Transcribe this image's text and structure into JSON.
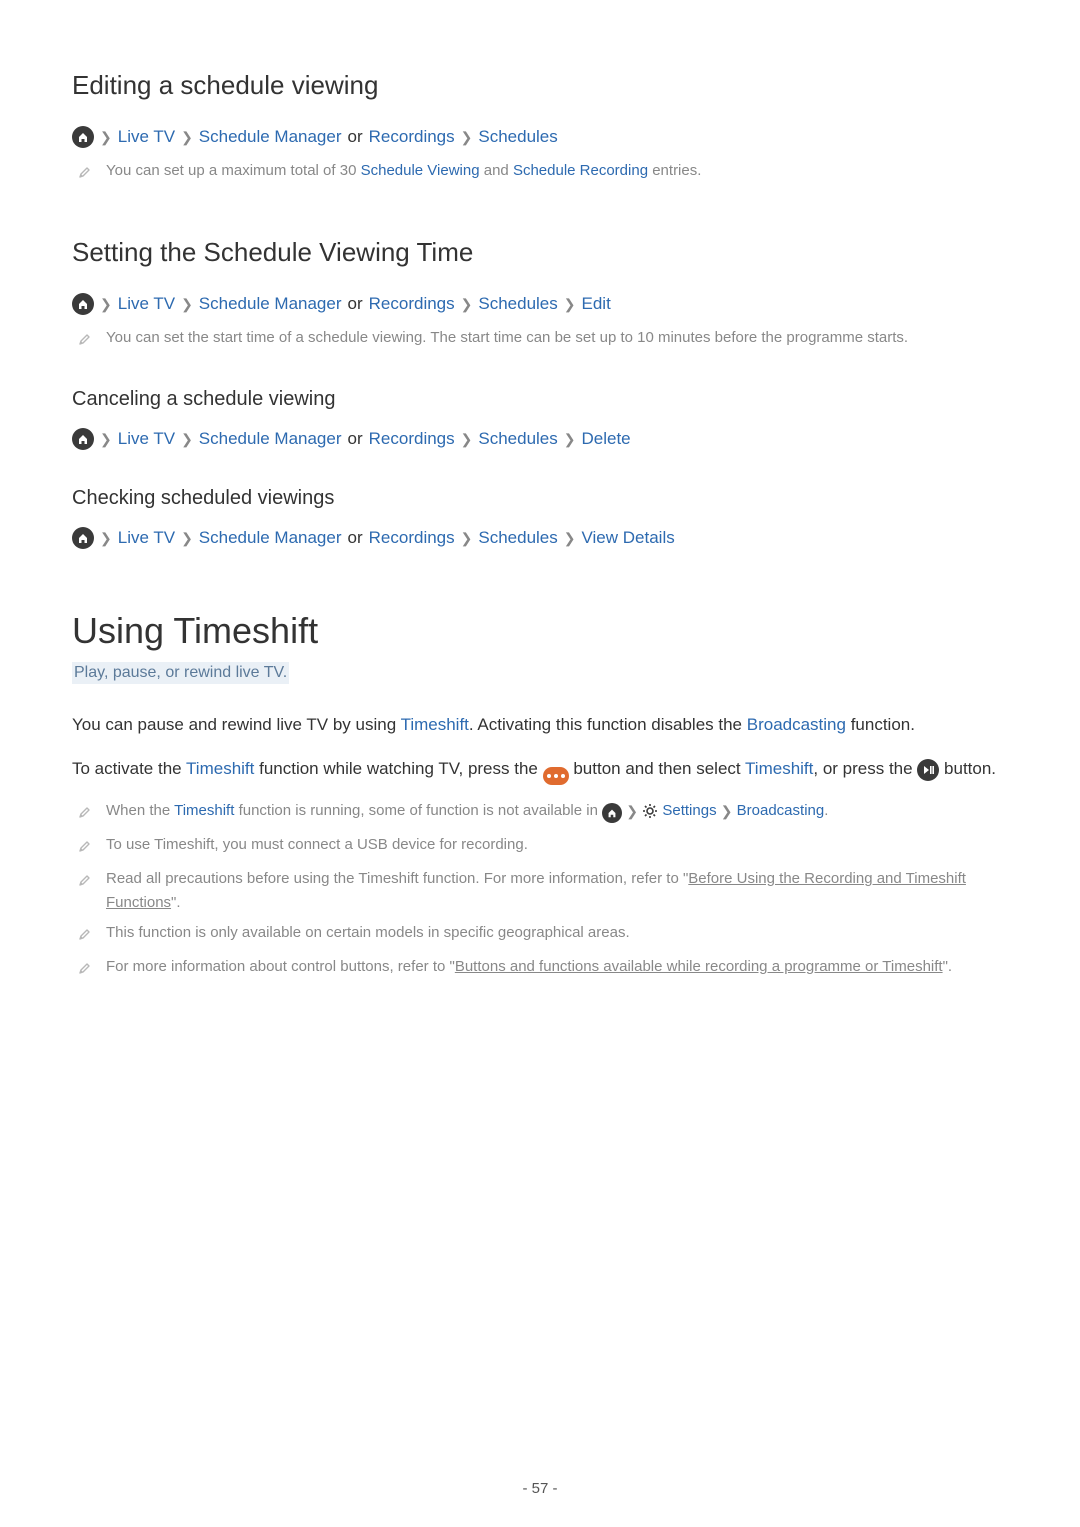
{
  "nav": {
    "live_tv": "Live TV",
    "schedule_manager": "Schedule Manager",
    "or": "or",
    "recordings": "Recordings",
    "schedules": "Schedules",
    "edit": "Edit",
    "delete": "Delete",
    "view_details": "View Details",
    "settings": "Settings",
    "broadcasting": "Broadcasting"
  },
  "editing": {
    "heading": "Editing a schedule viewing",
    "note_pre": "You can set up a maximum total of 30 ",
    "note_link1": "Schedule Viewing",
    "note_mid": " and ",
    "note_link2": "Schedule Recording",
    "note_post": " entries."
  },
  "setting": {
    "heading": "Setting the Schedule Viewing Time",
    "note": "You can set the start time of a schedule viewing. The start time can be set up to 10 minutes before the programme starts."
  },
  "canceling": {
    "heading": "Canceling a schedule viewing"
  },
  "checking": {
    "heading": "Checking scheduled viewings"
  },
  "timeshift": {
    "heading": "Using Timeshift",
    "subtitle": "Play, pause, or rewind live TV.",
    "p1_pre": "You can pause and rewind live TV by using ",
    "p1_link1": "Timeshift",
    "p1_mid": ". Activating this function disables the ",
    "p1_link2": "Broadcasting",
    "p1_post": " function.",
    "p2_pre": "To activate the ",
    "p2_link1": "Timeshift",
    "p2_mid1": " function while watching TV, press the ",
    "p2_mid2": " button and then select ",
    "p2_link2": "Timeshift",
    "p2_mid3": ", or press the ",
    "p2_post": " button.",
    "n1_pre": "When the ",
    "n1_link": "Timeshift",
    "n1_mid": " function is running, some of function is not available in ",
    "n1_post": ".",
    "n2": "To use Timeshift, you must connect a USB device for recording.",
    "n3_pre": "Read all precautions before using the Timeshift function. For more information, refer to \"",
    "n3_link": "Before Using the Recording and Timeshift Functions",
    "n3_post": "\".",
    "n4": "This function is only available on certain models in specific geographical areas.",
    "n5_pre": "For more information about control buttons, refer to \"",
    "n5_link": "Buttons and functions available while recording a programme or Timeshift",
    "n5_post": "\"."
  },
  "page": "- 57 -"
}
